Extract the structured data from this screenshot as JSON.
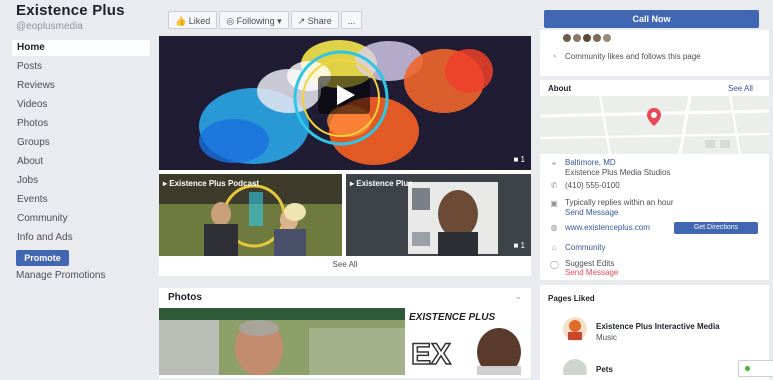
{
  "page": {
    "name": "Existence Plus",
    "handle": "@eoplusmedia"
  },
  "nav": [
    "Home",
    "Posts",
    "Reviews",
    "Videos",
    "Photos",
    "Groups",
    "About",
    "Jobs",
    "Events",
    "Community",
    "Info and Ads"
  ],
  "nav_active_index": 0,
  "promote": {
    "button": "Promote",
    "manage": "Manage Promotions"
  },
  "actionbar": [
    {
      "icon": "thumbs-up-icon",
      "label": "Liked"
    },
    {
      "icon": "rss-icon",
      "label": "Following"
    },
    {
      "icon": "share-icon",
      "label": "Share"
    },
    {
      "icon": "more-icon",
      "label": "..."
    }
  ],
  "videos": {
    "main_badge": "1",
    "thumb1_title": "Existence Plus Podcast",
    "thumb2_title": "Existence Plus",
    "thumb2_badge": "1",
    "see_all": "See All"
  },
  "photos": {
    "title": "Photos",
    "watermark": "EXISTENCE PLUS",
    "ex": "EX"
  },
  "right": {
    "call_button": "Call Now",
    "community_text": "Community likes and follows this page",
    "map_title": "About",
    "map_action": "See All",
    "address_line1": "Baltimore, MD",
    "address_line2": "Existence Plus Media Studios",
    "phone": "(410) 555-0100",
    "message": "Typically replies within an hour",
    "message_link": "Send Message",
    "website": "www.existenceplus.com",
    "get_directions": "Get Directions",
    "category": "Community",
    "suggest": "Suggest Edits",
    "suggest_link": "Send Message"
  },
  "pages_card": {
    "title": "Pages Liked",
    "item1": "Existence Plus Interactive Media",
    "item1_sub": "Music",
    "item2": "Pets"
  },
  "colors": {
    "brand": "#4267b2",
    "bg": "#e9ebee",
    "link": "#365899",
    "pin": "#e9485b"
  }
}
